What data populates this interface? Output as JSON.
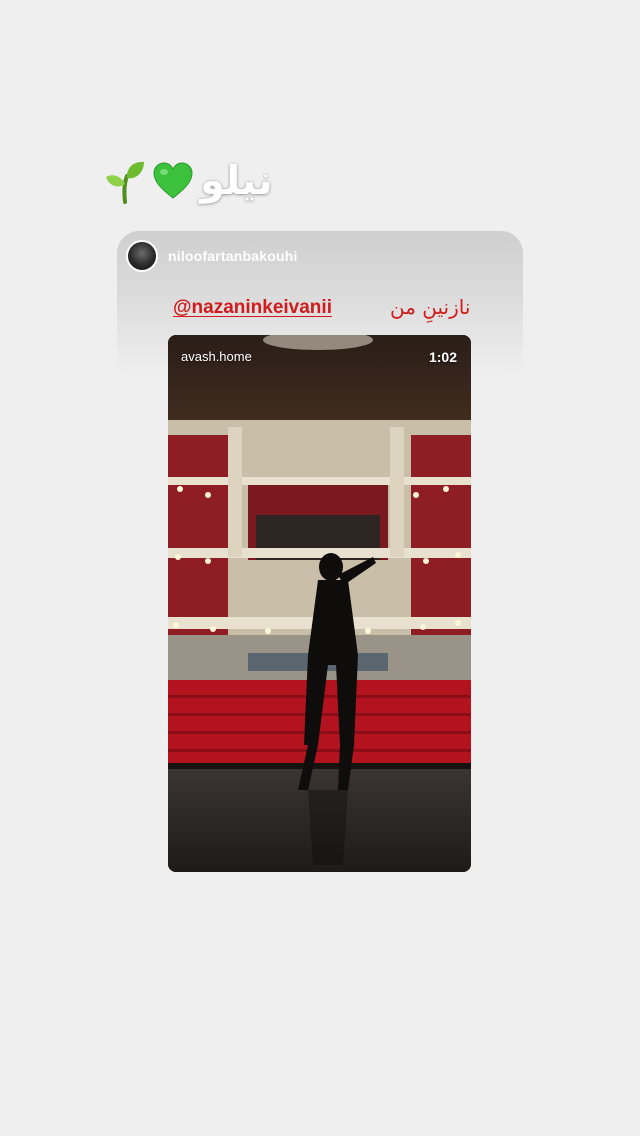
{
  "story": {
    "caption_text": "نیلو",
    "caption_emojis": [
      "green-heart-icon",
      "seedling-icon"
    ]
  },
  "shared_post": {
    "username": "niloofartanbakouhi",
    "mention": "@nazaninkeivanii",
    "persian_text": "نازنینِ من"
  },
  "video": {
    "account": "avash.home",
    "duration": "1:02"
  },
  "colors": {
    "background": "#efefef",
    "accent_red": "#d01c1c",
    "heart_green": "#3cc13c",
    "seat_red": "#b3121f"
  }
}
